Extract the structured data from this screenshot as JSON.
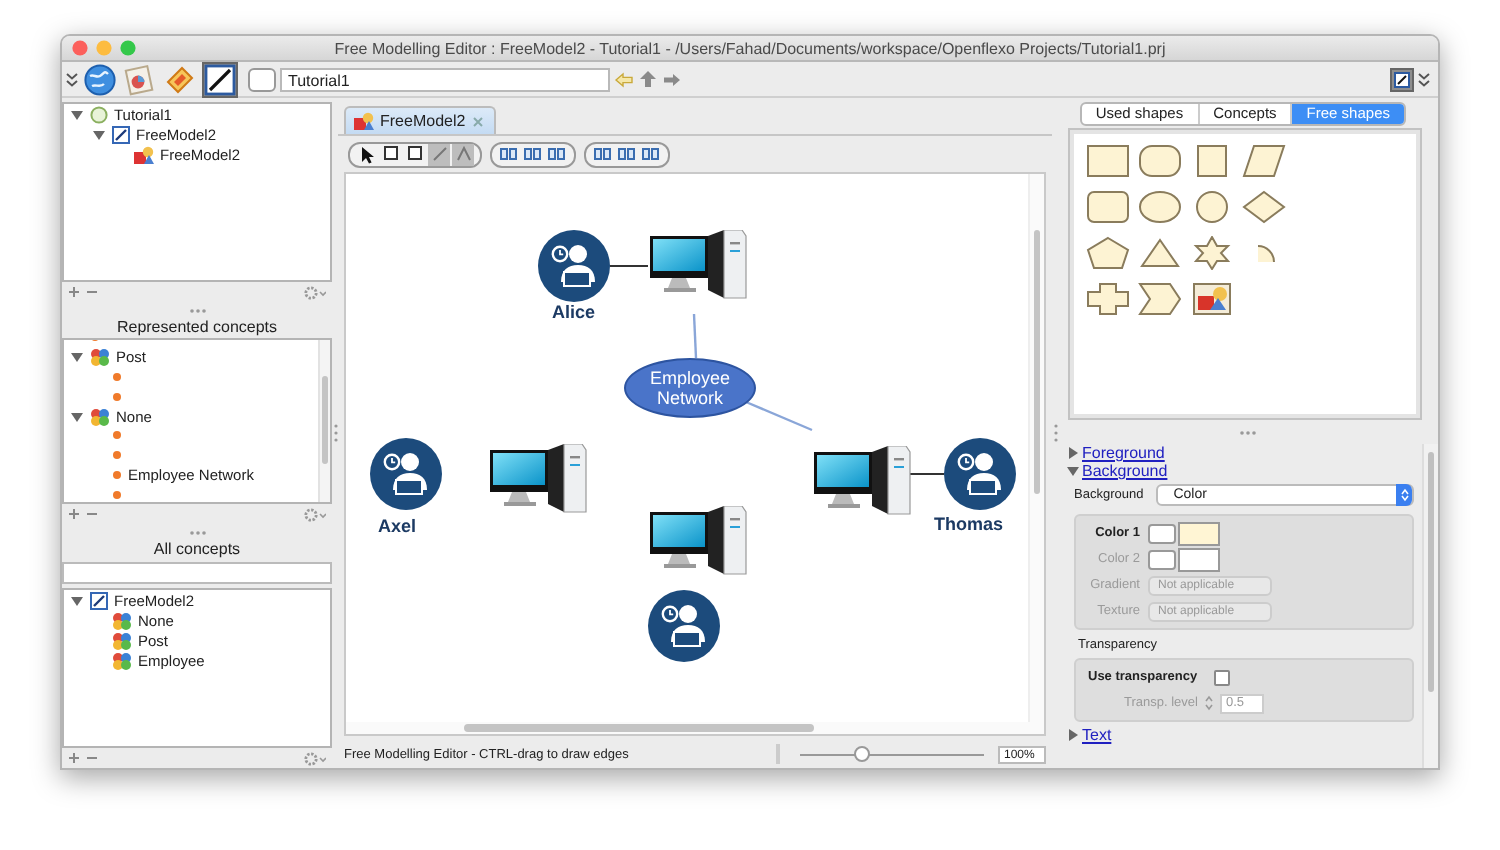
{
  "window": {
    "title": "Free Modelling Editor : FreeModel2 - Tutorial1 - /Users/Fahad/Documents/workspace/Openflexo Projects/Tutorial1.prj"
  },
  "toolbar": {
    "perspectives": [
      {
        "kind": "globe",
        "selected": false
      },
      {
        "kind": "chart",
        "selected": false
      },
      {
        "kind": "flexo",
        "selected": false
      },
      {
        "kind": "diagram",
        "selected": true
      }
    ],
    "address": "Tutorial1"
  },
  "project_tree": [
    {
      "label": "Tutorial1",
      "kind": "project",
      "expanded": true,
      "children": [
        {
          "label": "FreeModel2",
          "kind": "model",
          "expanded": true,
          "children": [
            {
              "label": "FreeModel2",
              "kind": "diagram"
            }
          ]
        }
      ]
    }
  ],
  "represented_concepts": {
    "title": "Represented concepts",
    "items": [
      {
        "kind": "instance"
      },
      {
        "kind": "concept",
        "label": "Post",
        "expanded": true,
        "children": [
          {
            "kind": "instance"
          },
          {
            "kind": "instance"
          }
        ]
      },
      {
        "kind": "concept",
        "label": "None",
        "expanded": true,
        "children": [
          {
            "kind": "instance"
          },
          {
            "kind": "instance"
          },
          {
            "kind": "instance",
            "label": "Employee Network"
          },
          {
            "kind": "instance"
          }
        ]
      }
    ]
  },
  "all_concepts": {
    "title": "All concepts",
    "items": [
      {
        "kind": "model",
        "label": "FreeModel2",
        "expanded": true,
        "children": [
          {
            "kind": "concept",
            "label": "None"
          },
          {
            "kind": "concept",
            "label": "Post"
          },
          {
            "kind": "concept",
            "label": "Employee"
          }
        ]
      }
    ]
  },
  "editor": {
    "tabs": [
      {
        "label": "FreeModel2",
        "selected": true
      }
    ],
    "diagram": {
      "concept": {
        "label": "Employee Network"
      },
      "employees": [
        {
          "kind": "employee",
          "label": "Alice"
        },
        {
          "kind": "employee",
          "label": "Axel"
        },
        {
          "kind": "employee",
          "label": "Thomas"
        },
        {
          "kind": "employee"
        }
      ]
    },
    "status": "Free Modelling Editor - CTRL-drag to draw edges",
    "zoom": {
      "level": 0.34,
      "reading": "100%"
    }
  },
  "palette": {
    "tabs": [
      {
        "label": "Used shapes",
        "selected": false
      },
      {
        "label": "Concepts",
        "selected": false
      },
      {
        "label": "Free shapes",
        "selected": true
      }
    ],
    "shapes": [
      {
        "kind": "rectangle"
      },
      {
        "kind": "rounded-rectangle"
      },
      {
        "kind": "square"
      },
      {
        "kind": "parallelogram"
      },
      {
        "kind": "rounded-square"
      },
      {
        "kind": "ellipse"
      },
      {
        "kind": "circle"
      },
      {
        "kind": "diamond"
      },
      {
        "kind": "pentagon"
      },
      {
        "kind": "triangle"
      },
      {
        "kind": "star"
      },
      {
        "kind": "arc"
      },
      {
        "kind": "cross"
      },
      {
        "kind": "chevron"
      },
      {
        "kind": "image"
      }
    ]
  },
  "inspector": {
    "sections": [
      {
        "label": "Foreground",
        "expanded": false
      },
      {
        "label": "Background",
        "expanded": true,
        "content": {
          "background": {
            "label": "Background",
            "value": "Color",
            "colors": [
              {
                "label": "Color 1",
                "color": "#fff5d4",
                "disabled": false
              },
              {
                "label": "Color 2",
                "color": "#ffffff",
                "disabled": true
              }
            ],
            "options": [
              {
                "label": "Gradient",
                "value": "Not applicable",
                "disabled": true
              },
              {
                "label": "Texture",
                "value": "Not applicable",
                "disabled": true
              }
            ]
          },
          "transparency": {
            "title": "Transparency",
            "label": "Use transparency",
            "checked": false,
            "level_label": "Transp. level",
            "level_value": "0.5",
            "level_disabled": true
          }
        }
      },
      {
        "label": "Text",
        "expanded": false
      }
    ]
  }
}
